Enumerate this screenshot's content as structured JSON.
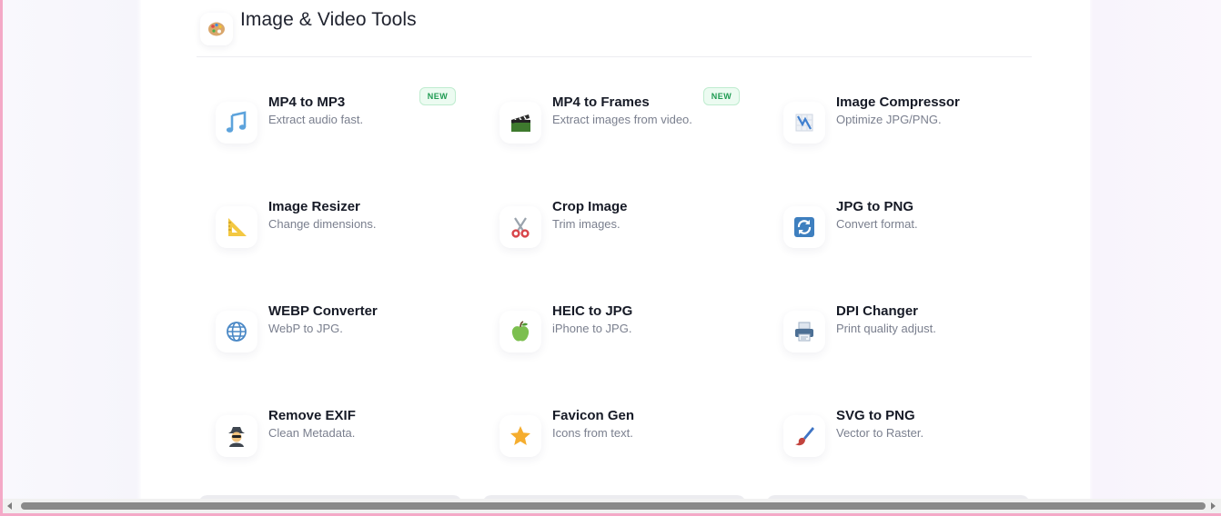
{
  "section": {
    "title": "Image & Video Tools",
    "icon": "palette-icon"
  },
  "tools": [
    {
      "name": "MP4 to MP3",
      "desc": "Extract audio fast.",
      "icon": "music-notes-icon",
      "badge": "NEW"
    },
    {
      "name": "MP4 to Frames",
      "desc": "Extract images from video.",
      "icon": "clapper-board-icon",
      "badge": "NEW"
    },
    {
      "name": "Image Compressor",
      "desc": "Optimize JPG/PNG.",
      "icon": "compression-chart-icon"
    },
    {
      "name": "Image Resizer",
      "desc": "Change dimensions.",
      "icon": "triangle-ruler-icon"
    },
    {
      "name": "Crop Image",
      "desc": "Trim images.",
      "icon": "scissors-icon"
    },
    {
      "name": "JPG to PNG",
      "desc": "Convert format.",
      "icon": "refresh-arrows-icon"
    },
    {
      "name": "WEBP Converter",
      "desc": "WebP to JPG.",
      "icon": "globe-icon"
    },
    {
      "name": "HEIC to JPG",
      "desc": "iPhone to JPG.",
      "icon": "green-apple-icon"
    },
    {
      "name": "DPI Changer",
      "desc": "Print quality adjust.",
      "icon": "printer-icon"
    },
    {
      "name": "Remove EXIF",
      "desc": "Clean Metadata.",
      "icon": "detective-icon"
    },
    {
      "name": "Favicon Gen",
      "desc": "Icons from text.",
      "icon": "star-icon"
    },
    {
      "name": "SVG to PNG",
      "desc": "Vector to Raster.",
      "icon": "paintbrush-icon"
    }
  ],
  "colors": {
    "frame_border": "#f4a9c7",
    "badge_text": "#1f9b52",
    "badge_bg": "#ecfbf1",
    "title_text": "#161a26",
    "desc_text": "#7a7f8e"
  }
}
